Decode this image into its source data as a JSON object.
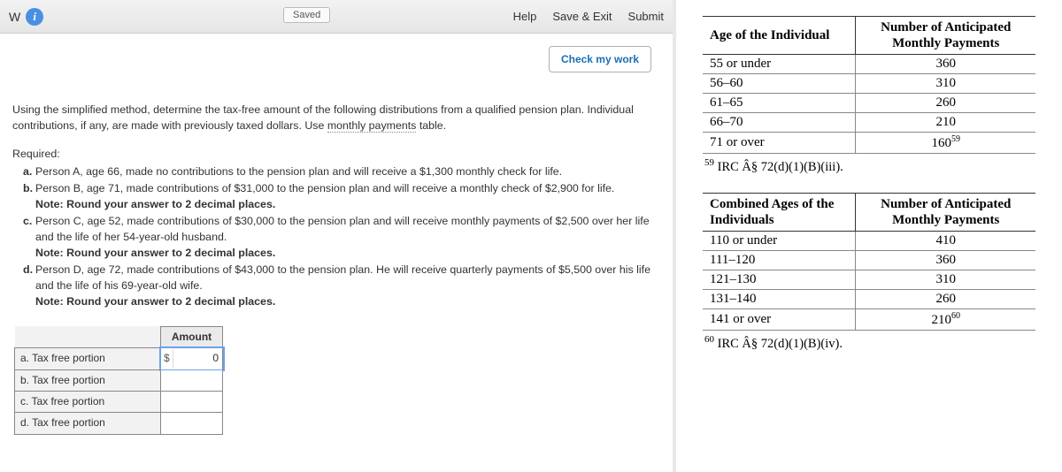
{
  "toolbar": {
    "brand_letter": "W",
    "saved": "Saved",
    "help": "Help",
    "save_exit": "Save & Exit",
    "submit": "Submit",
    "check_work": "Check my work"
  },
  "content": {
    "intro_pre": "Using the simplified method, determine the tax-free amount of the following distributions from a qualified pension plan. Individual contributions, if any, are made with previously taxed dollars. Use ",
    "intro_link": "monthly payments",
    "intro_post": " table.",
    "required_heading": "Required:",
    "items": {
      "a_letter": "a.",
      "a_text": "Person A, age 66, made no contributions to the pension plan and will receive a $1,300 monthly check for life.",
      "b_letter": "b.",
      "b_text": "Person B, age 71, made contributions of $31,000 to the pension plan and will receive a monthly check of $2,900 for life.",
      "b_note": "Note: Round your answer to 2 decimal places.",
      "c_letter": "c.",
      "c_text": "Person C, age 52, made contributions of $30,000 to the pension plan and will receive monthly payments of $2,500 over her life and the life of her 54-year-old husband.",
      "c_note": "Note: Round your answer to 2 decimal places.",
      "d_letter": "d.",
      "d_text": "Person D, age 72, made contributions of $43,000 to the pension plan. He will receive quarterly payments of $5,500 over his life and the life of his 69-year-old wife.",
      "d_note": "Note: Round your answer to 2 decimal places."
    },
    "amount_header": "Amount",
    "rows": {
      "a": "a. Tax free portion",
      "b": "b. Tax free portion",
      "c": "c. Tax free portion",
      "d": "d. Tax free portion"
    },
    "input_a": {
      "currency": "$",
      "value": "0"
    }
  },
  "ref1": {
    "h1": "Age of the Individual",
    "h2": "Number of Anticipated Monthly Payments",
    "rows": [
      {
        "age": "55 or under",
        "pay": "360"
      },
      {
        "age": "56–60",
        "pay": "310"
      },
      {
        "age": "61–65",
        "pay": "260"
      },
      {
        "age": "66–70",
        "pay": "210"
      },
      {
        "age": "71 or over",
        "pay": "160",
        "sup": "59"
      }
    ],
    "footnote_sup": "59",
    "footnote_text": " IRC Â§ 72(d)(1)(B)(iii)."
  },
  "ref2": {
    "h1": "Combined Ages of the Individuals",
    "h2": "Number of Anticipated Monthly Payments",
    "rows": [
      {
        "age": "110 or under",
        "pay": "410"
      },
      {
        "age": "111–120",
        "pay": "360"
      },
      {
        "age": "121–130",
        "pay": "310"
      },
      {
        "age": "131–140",
        "pay": "260"
      },
      {
        "age": "141 or over",
        "pay": "210",
        "sup": "60"
      }
    ],
    "footnote_sup": "60",
    "footnote_text": " IRC Â§ 72(d)(1)(B)(iv)."
  }
}
